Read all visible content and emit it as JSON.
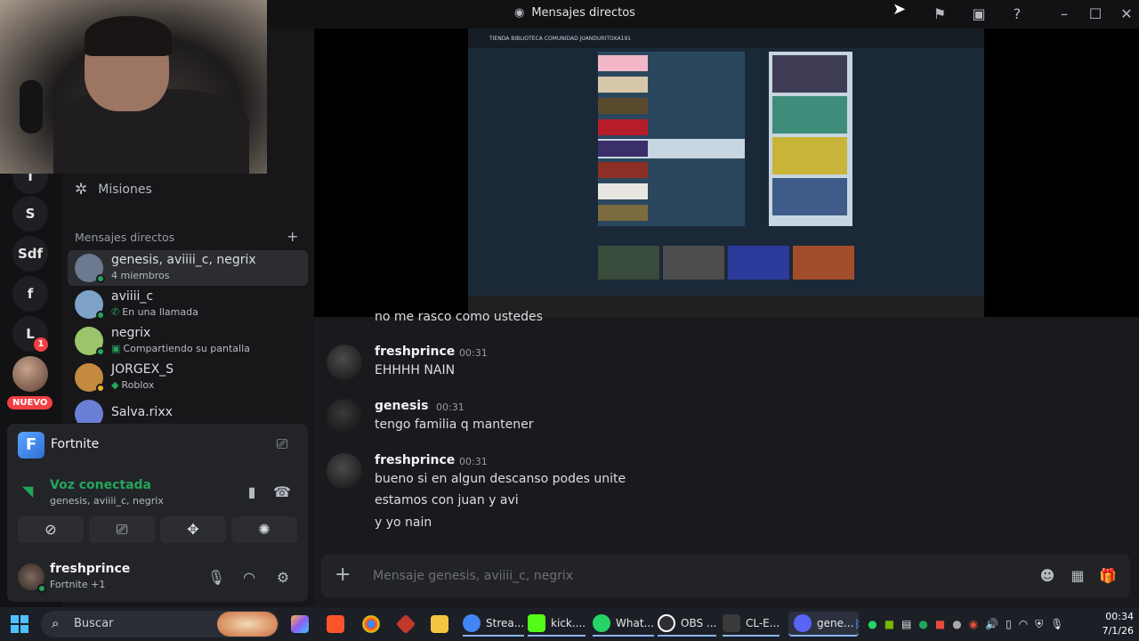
{
  "window": {
    "title": "Mensajes directos"
  },
  "servers": [
    {
      "label": "I"
    },
    {
      "label": "S"
    },
    {
      "label": "Sdf"
    },
    {
      "label": "f"
    },
    {
      "label": "L",
      "badge": "1"
    }
  ],
  "servers_badge_nuevo": "NUEVO",
  "sidebar": {
    "misiones": "Misiones",
    "dm_header": "Mensajes directos",
    "dms": [
      {
        "name": "genesis, aviiii_c, negrix",
        "sub": "4 miembros",
        "active": true,
        "color": "#6b7a8f"
      },
      {
        "name": "aviiii_c",
        "sub": "En una llamada",
        "color": "#7ea2c8"
      },
      {
        "name": "negrix",
        "sub": "Compartiendo su pantalla",
        "color": "#9bc46b"
      },
      {
        "name": "JORGEX_S",
        "sub": "Roblox",
        "color": "#c48a3e"
      },
      {
        "name": "Salva.rixx",
        "sub": "",
        "color": "#6b7fd7"
      }
    ]
  },
  "activity": {
    "game": "Fortnite"
  },
  "voice": {
    "status": "Voz conectada",
    "channel": "genesis, aviiii_c, negrix"
  },
  "user": {
    "name": "freshprince",
    "status": "Fortnite +1"
  },
  "stream": {
    "tabs": "TIENDA   BIBLIOTECA   COMUNIDAD   JUANDURITOXA191"
  },
  "messages": {
    "cut_line": "no me rasco como ustedes",
    "groups": [
      {
        "author": "freshprince",
        "time": "00:31",
        "lines": [
          "EHHHH NAIN"
        ]
      },
      {
        "author": "genesis",
        "time": "00:31",
        "lines": [
          "tengo familia q mantener"
        ]
      },
      {
        "author": "freshprince",
        "time": "00:31",
        "lines": [
          "bueno si en algun descanso podes unite",
          "estamos con juan y avi",
          "y yo nain"
        ]
      }
    ]
  },
  "composer": {
    "placeholder": "Mensaje genesis, aviiii_c, negrix"
  },
  "taskbar": {
    "search": "Buscar",
    "apps": [
      {
        "label": "Strea...",
        "color": "#4285f4"
      },
      {
        "label": "kick....",
        "color": "#53fc18"
      },
      {
        "label": "What...",
        "color": "#25d366"
      },
      {
        "label": "OBS ...",
        "color": "#302e31"
      },
      {
        "label": "CL-E...",
        "color": "#3a3a3a"
      },
      {
        "label": "gene...",
        "color": "#5865f2"
      }
    ],
    "clock_time": "00:34",
    "clock_date": "7/1/26"
  }
}
